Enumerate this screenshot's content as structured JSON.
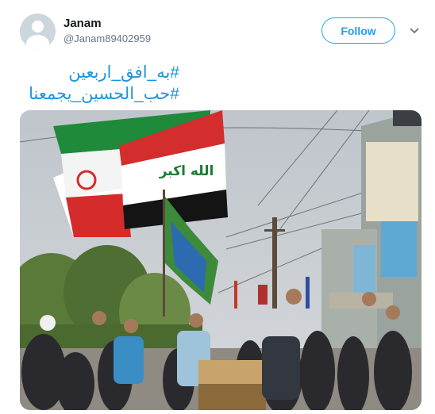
{
  "user": {
    "display_name": "Janam",
    "handle": "@Janam89402959",
    "avatar_icon": "default-profile-icon"
  },
  "follow_button": {
    "label": "Follow"
  },
  "menu": {
    "icon": "chevron-down-icon"
  },
  "tweet": {
    "hashtags": [
      "#به_افق_اربعین",
      "#حب_الحسین_یجمعنا"
    ]
  },
  "media": {
    "flag_text": "الله اكبر"
  },
  "colors": {
    "accent": "#1da1f2",
    "link": "#1b95e0",
    "secondary_text": "#657786"
  }
}
